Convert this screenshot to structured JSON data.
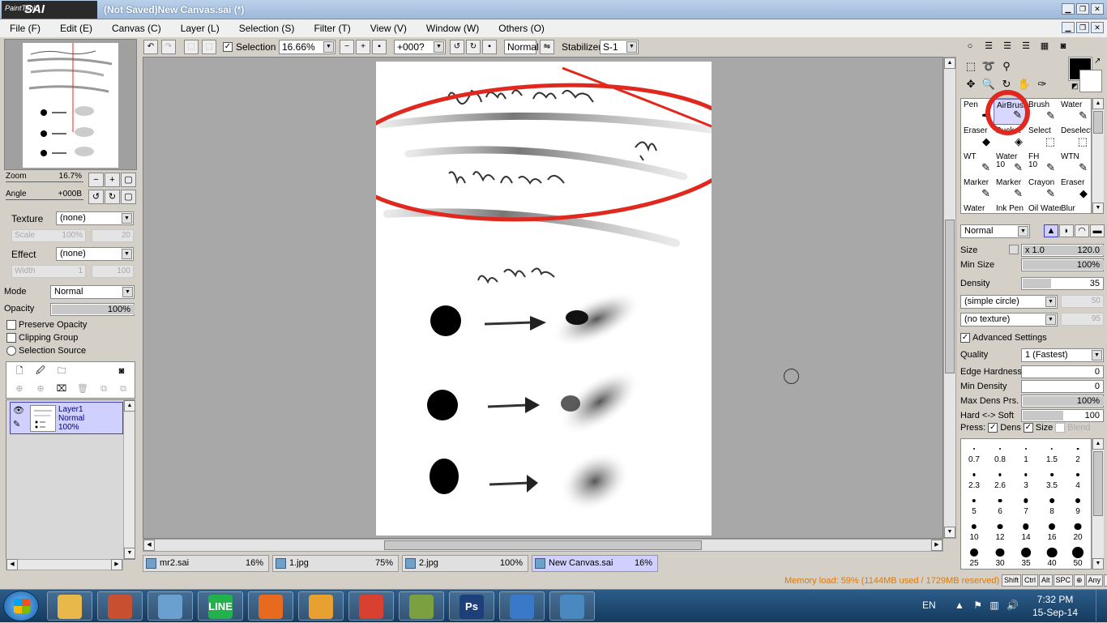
{
  "window": {
    "logo_small": "PaintTool",
    "logo_main": "SAI",
    "title": "(Not Saved)New Canvas.sai (*)"
  },
  "menu": [
    "File (F)",
    "Edit (E)",
    "Canvas (C)",
    "Layer (L)",
    "Selection (S)",
    "Filter (T)",
    "View (V)",
    "Window (W)",
    "Others (O)"
  ],
  "navigator": {
    "zoom_label": "Zoom",
    "zoom_value": "16.7%",
    "angle_label": "Angle",
    "angle_value": "+000B"
  },
  "brush_panel": {
    "texture_label": "Texture",
    "texture_value": "(none)",
    "scale_label": "Scale",
    "scale_value": "100%",
    "scale_num": "20",
    "effect_label": "Effect",
    "effect_value": "(none)",
    "width_label": "Width",
    "width_value": "1",
    "width_num": "100"
  },
  "layer_panel": {
    "mode_label": "Mode",
    "mode_value": "Normal",
    "opacity_label": "Opacity",
    "opacity_value": "100%",
    "preserve_opacity": "Preserve Opacity",
    "clipping_group": "Clipping Group",
    "selection_source": "Selection Source",
    "layer_name": "Layer1",
    "layer_mode": "Normal",
    "layer_opacity": "100%"
  },
  "toolbar": {
    "selection_label": "Selection",
    "zoom": "16.66%",
    "angle": "+000?",
    "blend": "Normal",
    "stabilizer_label": "Stabilizer",
    "stabilizer_value": "S-1"
  },
  "doc_tabs": [
    {
      "name": "mr2.sai",
      "pct": "16%"
    },
    {
      "name": "1.jpg",
      "pct": "75%"
    },
    {
      "name": "2.jpg",
      "pct": "100%"
    },
    {
      "name": "New Canvas.sai",
      "pct": "16%"
    }
  ],
  "brushes": [
    {
      "name": "Pen",
      "num": "",
      "glyph": "✒"
    },
    {
      "name": "AirBrush",
      "num": "",
      "glyph": "✎"
    },
    {
      "name": "Brush",
      "num": "",
      "glyph": "✎"
    },
    {
      "name": "Water",
      "num": "",
      "glyph": "✎"
    },
    {
      "name": "Eraser",
      "num": "",
      "glyph": "◆"
    },
    {
      "name": "Bucket",
      "num": "",
      "glyph": "◈"
    },
    {
      "name": "Select",
      "num": "",
      "glyph": "⬚"
    },
    {
      "name": "Deselect",
      "num": "",
      "glyph": "⬚"
    },
    {
      "name": "WT",
      "num": "",
      "glyph": "✎"
    },
    {
      "name": "Water",
      "num": "10",
      "glyph": "✎"
    },
    {
      "name": "FH",
      "num": "10",
      "glyph": "✎"
    },
    {
      "name": "WTN",
      "num": "",
      "glyph": "✎"
    },
    {
      "name": "Marker",
      "num": "",
      "glyph": "✎"
    },
    {
      "name": "Marker",
      "num": "",
      "glyph": "✎"
    },
    {
      "name": "Crayon",
      "num": "",
      "glyph": "✎"
    },
    {
      "name": "Eraser",
      "num": "",
      "glyph": "◆"
    },
    {
      "name": "Water",
      "num": "",
      "glyph": ""
    },
    {
      "name": "Ink Pen",
      "num": "",
      "glyph": ""
    },
    {
      "name": "Oil Water",
      "num": "",
      "glyph": ""
    },
    {
      "name": "Blur",
      "num": "",
      "glyph": ""
    }
  ],
  "brush_props": {
    "blend_mode": "Normal",
    "size_label": "Size",
    "size_mult": "x 1.0",
    "size_value": "120.0",
    "min_size_label": "Min Size",
    "min_size_value": "100%",
    "density_label": "Density",
    "density_value": "35",
    "shape": "(simple circle)",
    "shape_num": "50",
    "texture": "(no texture)",
    "texture_num": "95",
    "advanced": "Advanced Settings",
    "quality_label": "Quality",
    "quality_value": "1 (Fastest)",
    "edge_label": "Edge Hardness",
    "edge_value": "0",
    "min_dens_label": "Min Density",
    "min_dens_value": "0",
    "max_dens_label": "Max Dens Prs.",
    "max_dens_value": "100%",
    "hard_soft_label": "Hard <-> Soft",
    "hard_soft_value": "100",
    "press_label": "Press:",
    "press_dens": "Dens",
    "press_size": "Size",
    "press_blend": "Blend"
  },
  "brush_sizes": [
    "0.7",
    "0.8",
    "1",
    "1.5",
    "2",
    "2.3",
    "2.6",
    "3",
    "3.5",
    "4",
    "5",
    "6",
    "7",
    "8",
    "9",
    "10",
    "12",
    "14",
    "16",
    "20",
    "25",
    "30",
    "35",
    "40",
    "50"
  ],
  "status": {
    "memory": "Memory load: 59% (1144MB used / 1729MB reserved)",
    "keys": [
      "Shift",
      "Ctrl",
      "Alt",
      "SPC",
      "⊕",
      "Any",
      "✎"
    ]
  },
  "taskbar": {
    "apps": [
      {
        "name": "explorer",
        "label": "",
        "color": "#e8b84a"
      },
      {
        "name": "app-2",
        "label": "",
        "color": "#c85030"
      },
      {
        "name": "app-3",
        "label": "",
        "color": "#6aa0d0"
      },
      {
        "name": "line",
        "label": "LINE",
        "color": "#22b24c"
      },
      {
        "name": "firefox",
        "label": "",
        "color": "#e86a1e"
      },
      {
        "name": "media",
        "label": "",
        "color": "#e8a030"
      },
      {
        "name": "chrome",
        "label": "",
        "color": "#d84030"
      },
      {
        "name": "sai",
        "label": "",
        "color": "#7aa040"
      },
      {
        "name": "photoshop",
        "label": "Ps",
        "color": "#1d3f7a"
      },
      {
        "name": "paint",
        "label": "",
        "color": "#3a78c8"
      },
      {
        "name": "photos",
        "label": "",
        "color": "#4a88c0"
      }
    ],
    "lang": "EN",
    "time": "7:32 PM",
    "date": "15-Sep-14"
  }
}
